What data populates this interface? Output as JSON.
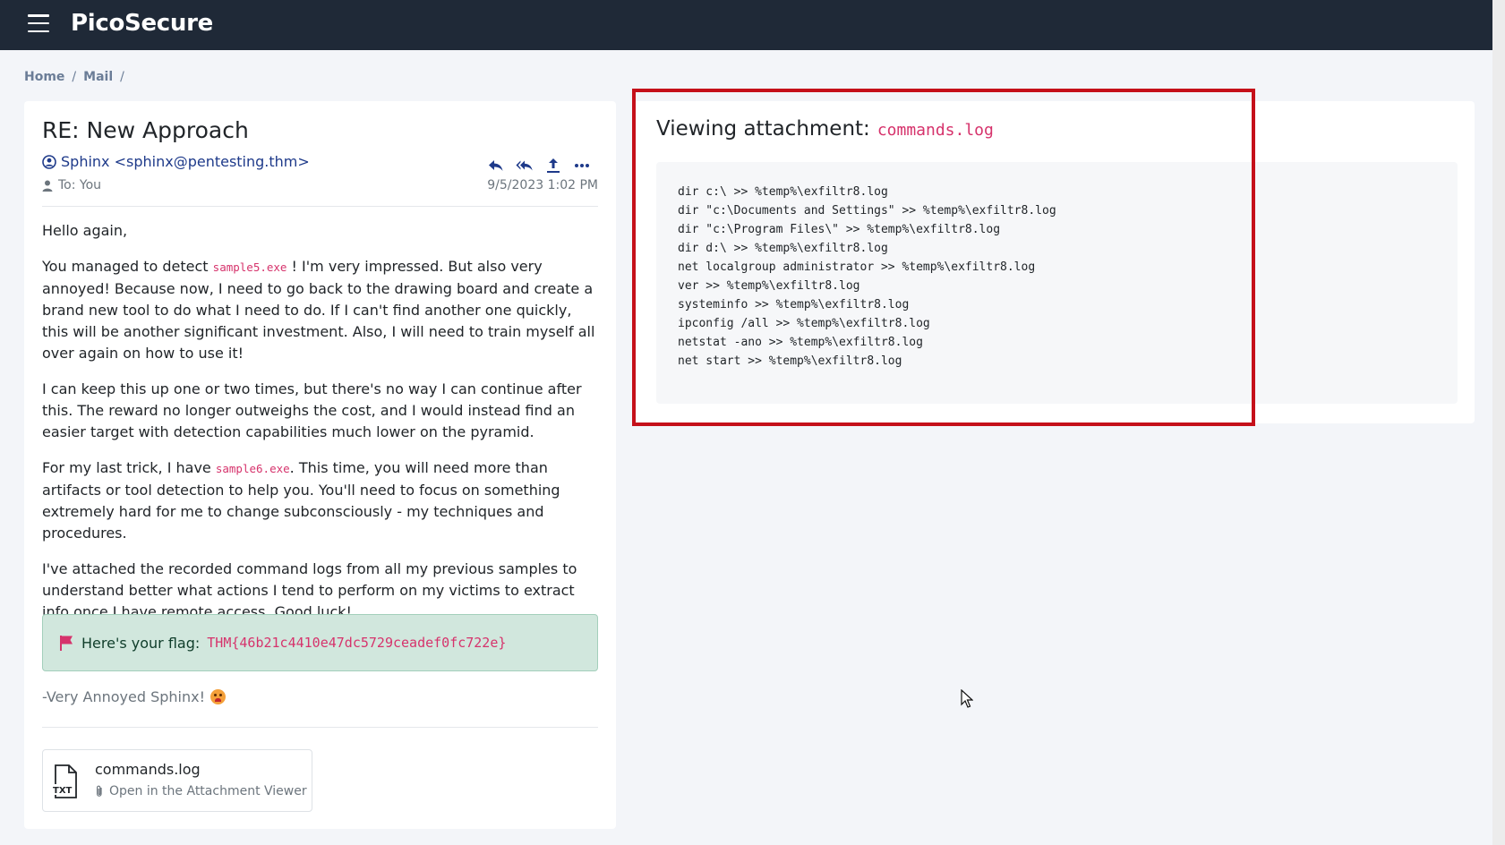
{
  "app": {
    "brand": "PicoSecure"
  },
  "breadcrumb": {
    "items": [
      "Home",
      "Mail"
    ],
    "separator": "/"
  },
  "mail": {
    "subject": "RE: New Approach",
    "sender": "Sphinx <sphinx@pentesting.thm>",
    "to": "To: You",
    "date": "9/5/2023 1:02 PM",
    "greeting": "Hello again,",
    "p1_before": "You managed to detect ",
    "p1_code": "sample5.exe",
    "p1_after": " ! I'm very impressed. But also very annoyed! Because now, I need to go back to the drawing board and create a brand new tool to do what I need to do. If I can't find another one quickly, this will be another significant investment. Also, I will need to train myself all over again on how to use it!",
    "p2": "I can keep this up one or two times, but there's no way I can continue after this. The reward no longer outweighs the cost, and I would instead find an easier target with detection capabilities much lower on the pyramid.",
    "p3_before": "For my last trick, I have ",
    "p3_code": "sample6.exe",
    "p3_after": ". This time, you will need more than artifacts or tool detection to help you. You'll need to focus on something extremely hard for me to change subconsciously - my techniques and procedures.",
    "p4": "I've attached the recorded command logs from all my previous samples to understand better what actions I tend to perform on my victims to extract info once I have remote access. Good luck!",
    "flag_label": "Here's your flag: ",
    "flag_value": "THM{46b21c4410e47dc5729ceadef0fc722e}",
    "signoff": "-Very Annoyed Sphinx!",
    "attachment": {
      "name": "commands.log",
      "type": "TXT",
      "open_label": "Open in the Attachment Viewer"
    }
  },
  "viewer": {
    "title": "Viewing attachment:",
    "filename": "commands.log",
    "lines": [
      "dir c:\\ >> %temp%\\exfiltr8.log",
      "dir \"c:\\Documents and Settings\" >> %temp%\\exfiltr8.log",
      "dir \"c:\\Program Files\\\" >> %temp%\\exfiltr8.log",
      "dir d:\\ >> %temp%\\exfiltr8.log",
      "net localgroup administrator >> %temp%\\exfiltr8.log",
      "ver >> %temp%\\exfiltr8.log",
      "systeminfo >> %temp%\\exfiltr8.log",
      "ipconfig /all >> %temp%\\exfiltr8.log",
      "netstat -ano >> %temp%\\exfiltr8.log",
      "net start >> %temp%\\exfiltr8.log"
    ]
  },
  "colors": {
    "navbar": "#1f2937",
    "accent_code": "#d6336c",
    "highlight": "#c5101a",
    "flag_bg": "#d1e7dd"
  }
}
